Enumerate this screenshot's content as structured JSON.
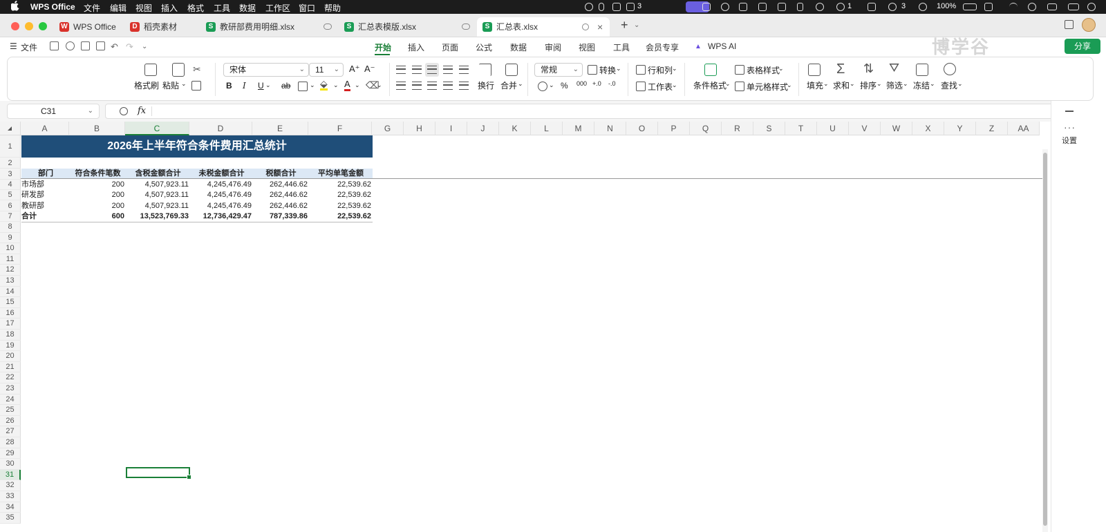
{
  "menubar": {
    "app_name": "WPS Office",
    "items": [
      "文件",
      "编辑",
      "视图",
      "插入",
      "格式",
      "工具",
      "数据",
      "工作区",
      "窗口",
      "帮助"
    ],
    "status": {
      "n1": "3",
      "n2": "1",
      "n3": "3",
      "battery": "100%",
      "time_hidden": ""
    }
  },
  "tabs": [
    {
      "label": "WPS Office",
      "icon_color": "#d9322b"
    },
    {
      "label": "稻壳素材",
      "icon_color": "#d9322b"
    },
    {
      "label": "教研部费用明细.xlsx",
      "icon_color": "#1a9c55"
    },
    {
      "label": "汇总表模版.xlsx",
      "icon_color": "#1a9c55"
    },
    {
      "label": "汇总表.xlsx",
      "icon_color": "#1a9c55"
    }
  ],
  "quickbar": {
    "file": "文件"
  },
  "ribbon_tabs": [
    "开始",
    "插入",
    "页面",
    "公式",
    "数据",
    "审阅",
    "视图",
    "工具",
    "会员专享",
    "WPS AI"
  ],
  "watermark": "博学谷",
  "share_label": "分享",
  "ribbon": {
    "format_painter": "格式刷",
    "paste": "粘贴",
    "font_name": "宋体",
    "font_size": "11",
    "wrap": "换行",
    "merge": "合并",
    "number_format": "常规",
    "convert": "转换",
    "rows_cols": "行和列",
    "worksheet": "工作表",
    "cond_format": "条件格式",
    "table_style": "表格样式",
    "cell_style": "单元格样式",
    "fill": "填充",
    "sum": "求和",
    "sort": "排序",
    "filter": "筛选",
    "freeze": "冻结",
    "find": "查找"
  },
  "formula_bar": {
    "cell_ref": "C31",
    "fx": "fx",
    "content": ""
  },
  "columns": [
    "A",
    "B",
    "C",
    "D",
    "E",
    "F",
    "G",
    "H",
    "I",
    "J",
    "K",
    "L",
    "M",
    "N",
    "O",
    "P",
    "Q",
    "R",
    "S",
    "T",
    "U",
    "V",
    "W",
    "X",
    "Y",
    "Z",
    "AA"
  ],
  "rows": [
    "1",
    "2",
    "3",
    "4",
    "5",
    "6",
    "7",
    "8",
    "9",
    "10",
    "11",
    "12",
    "13",
    "14",
    "15",
    "16",
    "17",
    "18",
    "19",
    "20",
    "21",
    "22",
    "23",
    "24",
    "25",
    "26",
    "27",
    "28",
    "29",
    "30",
    "31",
    "32",
    "33",
    "34",
    "35"
  ],
  "sheet": {
    "title": "2026年上半年符合条件费用汇总统计",
    "headers": [
      "部门",
      "符合条件笔数",
      "含税金额合计",
      "未税金额合计",
      "税额合计",
      "平均单笔金额"
    ],
    "data": [
      [
        "市场部",
        "200",
        "4,507,923.11",
        "4,245,476.49",
        "262,446.62",
        "22,539.62"
      ],
      [
        "研发部",
        "200",
        "4,507,923.11",
        "4,245,476.49",
        "262,446.62",
        "22,539.62"
      ],
      [
        "教研部",
        "200",
        "4,507,923.11",
        "4,245,476.49",
        "262,446.62",
        "22,539.62"
      ]
    ],
    "total": [
      "合计",
      "600",
      "13,523,769.33",
      "12,736,429.47",
      "787,339.86",
      "22,539.62"
    ]
  },
  "side_panel": {
    "settings": "设置"
  }
}
